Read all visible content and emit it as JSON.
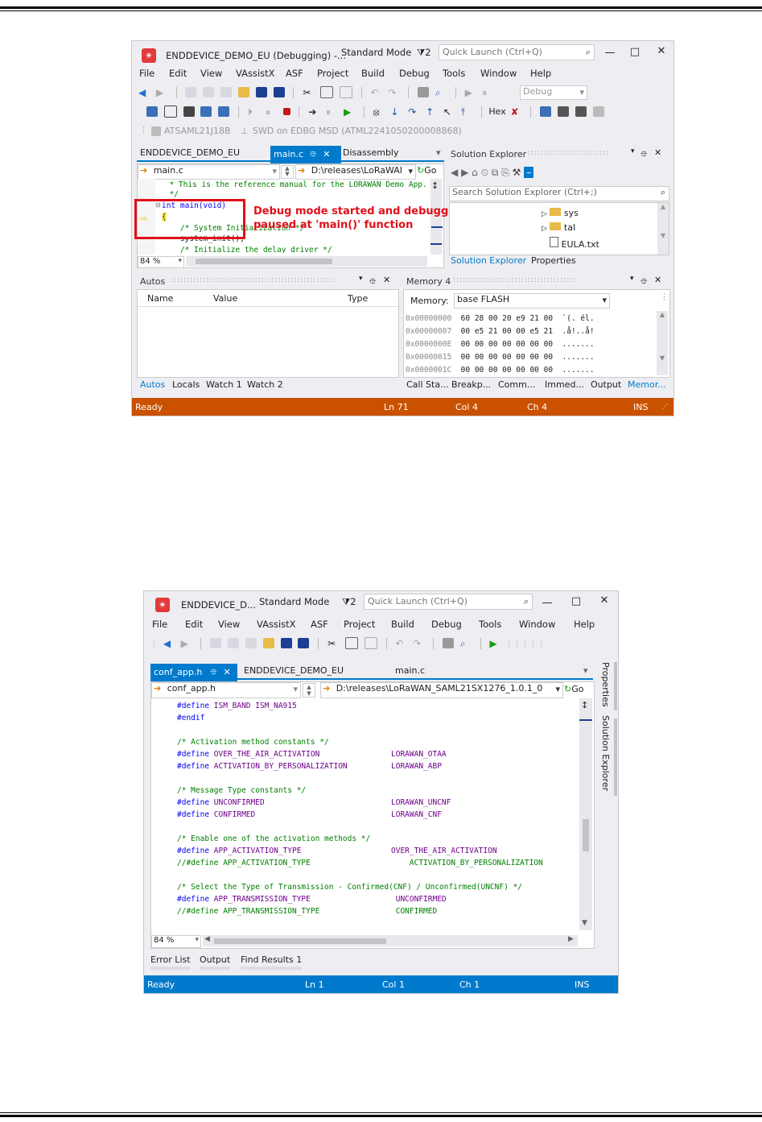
{
  "screen1": {
    "title": "ENDDEVICE_DEMO_EU (Debugging) -...",
    "mode": "Standard Mode",
    "notif": "2",
    "quick_launch": "Quick Launch (Ctrl+Q)",
    "menu": [
      "File",
      "Edit",
      "View",
      "VAssistX",
      "ASF",
      "Project",
      "Build",
      "Debug",
      "Tools",
      "Window",
      "Help"
    ],
    "config": "Debug",
    "hex_label": "Hex",
    "device": "ATSAML21J18B",
    "tool": "SWD on EDBG MSD (ATML2241050200008868)",
    "doc_tabs": [
      "ENDDEVICE_DEMO_EU",
      "main.c",
      "Disassembly"
    ],
    "file_combo": "main.c",
    "path_combo": "D:\\releases\\LoRaWAI",
    "go": "Go",
    "code": [
      "  * This is the reference manual for the LORAWAN Demo App.",
      "  */",
      "int main(void)",
      "{",
      "    /* System Initialization */",
      "    system_init();",
      "    /* Initialize the delay driver */"
    ],
    "zoom": "84 %",
    "annotation": [
      "Debug mode started and debugger",
      "paused at 'main()' function"
    ],
    "solution": {
      "title": "Solution Explorer",
      "search": "Search Solution Explorer (Ctrl+;)",
      "items": [
        "sys",
        "tal",
        "EULA.txt"
      ],
      "tabs": [
        "Solution Explorer",
        "Properties"
      ]
    },
    "autos": {
      "title": "Autos",
      "cols": [
        "Name",
        "Value",
        "Type"
      ],
      "tabs": [
        "Autos",
        "Locals",
        "Watch 1",
        "Watch 2"
      ]
    },
    "memory": {
      "title": "Memory 4",
      "label": "Memory:",
      "select": "base FLASH",
      "rows": [
        {
          "addr": "0x00000000",
          "bytes": "60 28 00 20 e9 21 00",
          "ascii": "`(. él."
        },
        {
          "addr": "0x00000007",
          "bytes": "00 e5 21 00 00 e5 21",
          "ascii": ".å!..å!"
        },
        {
          "addr": "0x0000000E",
          "bytes": "00 00 00 00 00 00 00",
          "ascii": "......."
        },
        {
          "addr": "0x00000015",
          "bytes": "00 00 00 00 00 00 00",
          "ascii": "......."
        },
        {
          "addr": "0x0000001C",
          "bytes": "00 00 00 00 00 00 00",
          "ascii": "......."
        }
      ],
      "tabs": [
        "Call Sta...",
        "Breakp...",
        "Comm...",
        "Immed...",
        "Output",
        "Memor..."
      ]
    },
    "status": {
      "ready": "Ready",
      "ln": "Ln 71",
      "col": "Col 4",
      "ch": "Ch 4",
      "ins": "INS"
    }
  },
  "screen2": {
    "title": "ENDDEVICE_D...",
    "mode": "Standard Mode",
    "notif": "2",
    "quick_launch": "Quick Launch (Ctrl+Q)",
    "menu": [
      "File",
      "Edit",
      "View",
      "VAssistX",
      "ASF",
      "Project",
      "Build",
      "Debug",
      "Tools",
      "Window",
      "Help"
    ],
    "doc_tabs": [
      "conf_app.h",
      "ENDDEVICE_DEMO_EU",
      "main.c"
    ],
    "file_combo": "conf_app.h",
    "path_combo": "D:\\releases\\LoRaWAN_SAML21SX1276_1.0.1_0",
    "go": "Go",
    "side_tabs": [
      "Properties",
      "Solution Explorer"
    ],
    "code": [
      {
        "a": "#define",
        "b": " ISM_BAND ISM_NA915",
        "c": ""
      },
      {
        "a": "#endif",
        "b": "",
        "c": ""
      },
      {
        "a": "",
        "b": "",
        "c": ""
      },
      {
        "cm": "/* Activation method constants */"
      },
      {
        "a": "#define",
        "b": " OVER_THE_AIR_ACTIVATION",
        "c": "LORAWAN_OTAA"
      },
      {
        "a": "#define",
        "b": " ACTIVATION_BY_PERSONALIZATION",
        "c": "LORAWAN_ABP"
      },
      {
        "a": "",
        "b": "",
        "c": ""
      },
      {
        "cm": "/* Message Type constants */"
      },
      {
        "a": "#define",
        "b": " UNCONFIRMED",
        "c": "LORAWAN_UNCNF"
      },
      {
        "a": "#define",
        "b": " CONFIRMED",
        "c": "LORAWAN_CNF"
      },
      {
        "a": "",
        "b": "",
        "c": ""
      },
      {
        "cm": "/* Enable one of the activation methods */"
      },
      {
        "a": "#define",
        "b": " APP_ACTIVATION_TYPE",
        "c": "OVER_THE_AIR_ACTIVATION"
      },
      {
        "a": "//#define",
        "b": " APP_ACTIVATION_TYPE",
        "c": "    ACTIVATION_BY_PERSONALIZATION"
      },
      {
        "a": "",
        "b": "",
        "c": ""
      },
      {
        "cm": "/* Select the Type of Transmission - Confirmed(CNF) / Unconfirmed(UNCNF) */"
      },
      {
        "a": "#define",
        "b": " APP_TRANSMISSION_TYPE",
        "c": " UNCONFIRMED"
      },
      {
        "a": "//#define",
        "b": " APP_TRANSMISSION_TYPE",
        "c": " CONFIRMED"
      }
    ],
    "zoom": "84 %",
    "bottom_tabs": [
      "Error List",
      "Output",
      "Find Results 1"
    ],
    "status": {
      "ready": "Ready",
      "ln": "Ln 1",
      "col": "Col 1",
      "ch": "Ch 1",
      "ins": "INS"
    }
  }
}
